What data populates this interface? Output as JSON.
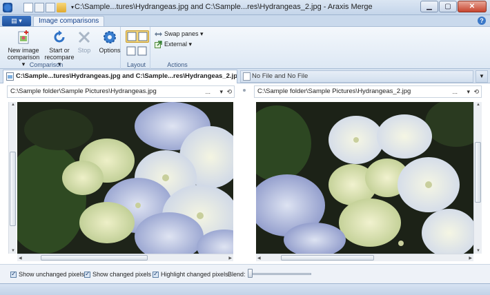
{
  "window": {
    "title": "C:\\Sample...tures\\Hydrangeas.jpg and C:\\Sample...res\\Hydrangeas_2.jpg - Araxis Merge"
  },
  "ribbon_tabs": {
    "active": "Image comparisons",
    "help": "?"
  },
  "ribbon": {
    "comparison_group": {
      "label": "Comparison",
      "new_image_line1": "New image",
      "new_image_line2": "comparison ▾",
      "start_line1": "Start or",
      "start_line2": "recompare ▾",
      "stop": "Stop"
    },
    "options_label": "Options",
    "layout_group": {
      "label": "Layout"
    },
    "actions_group": {
      "label": "Actions",
      "swap_panes": "Swap panes ▾",
      "external": "External ▾"
    }
  },
  "doc_tabs": {
    "active": "C:\\Sample...tures\\Hydrangeas.jpg and C:\\Sample...res\\Hydrangeas_2.jpg",
    "other": "No File and No File"
  },
  "panes": {
    "left_path": "C:\\Sample folder\\Sample Pictures\\Hydrangeas.jpg",
    "right_path": "C:\\Sample folder\\Sample Pictures\\Hydrangeas_2.jpg",
    "ellipsis": "...",
    "dropdown": "▾",
    "history": "⟲"
  },
  "options": {
    "show_unchanged": "Show unchanged pixels",
    "show_changed": "Show changed pixels",
    "highlight_changed": "Highlight changed pixels",
    "blend_label": "Blend:",
    "show_unchanged_checked": true,
    "show_changed_checked": true,
    "highlight_changed_checked": true,
    "blend": 0
  },
  "colors": {
    "accent": "#15428b",
    "ribbon_bg": "#dde8f4",
    "petal": "#d6deee"
  }
}
